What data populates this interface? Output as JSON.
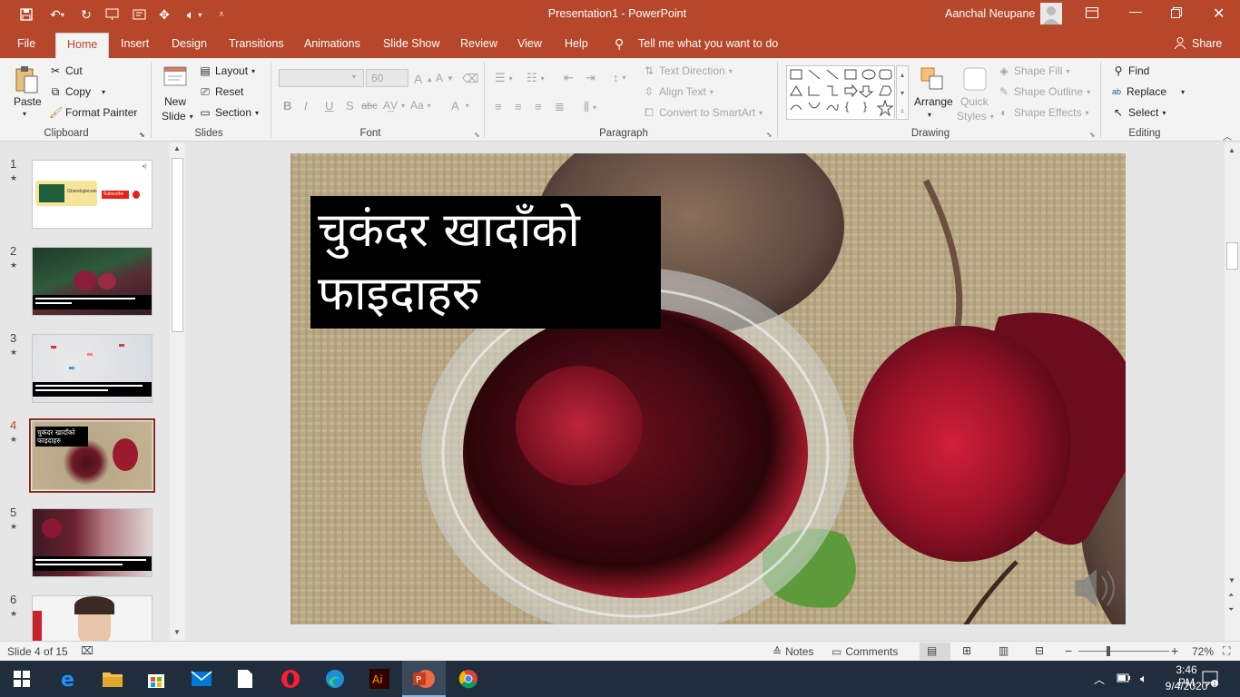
{
  "window": {
    "doc_title": "Presentation1  -  PowerPoint",
    "user_name": "Aanchal Neupane"
  },
  "tabs": [
    "File",
    "Home",
    "Insert",
    "Design",
    "Transitions",
    "Animations",
    "Slide Show",
    "Review",
    "View",
    "Help"
  ],
  "tell_me": "Tell me what you want to do",
  "share_label": "Share",
  "clipboard": {
    "paste": "Paste",
    "cut": "Cut",
    "copy": "Copy",
    "format_painter": "Format Painter",
    "group": "Clipboard"
  },
  "slides_group": {
    "new_slide_1": "New",
    "new_slide_2": "Slide",
    "layout": "Layout",
    "reset": "Reset",
    "section": "Section",
    "group": "Slides"
  },
  "font": {
    "size": "60",
    "group": "Font",
    "b": "B",
    "i": "I",
    "u": "U",
    "s": "S",
    "abc": "abc",
    "aa": "Aa",
    "a_up": "A",
    "a_color": "A"
  },
  "paragraph": {
    "text_direction": "Text Direction",
    "align_text": "Align Text",
    "smartart": "Convert to SmartArt",
    "group": "Paragraph"
  },
  "drawing": {
    "arrange": "Arrange",
    "quick_1": "Quick",
    "quick_2": "Styles",
    "shape_fill": "Shape Fill",
    "shape_outline": "Shape Outline",
    "shape_effects": "Shape Effects",
    "group": "Drawing"
  },
  "editing": {
    "find": "Find",
    "replace": "Replace",
    "select": "Select",
    "group": "Editing"
  },
  "thumbnails": [
    {
      "num": "1",
      "star": "★"
    },
    {
      "num": "2",
      "star": "★"
    },
    {
      "num": "3",
      "star": "★"
    },
    {
      "num": "4",
      "star": "★"
    },
    {
      "num": "5",
      "star": "★"
    },
    {
      "num": "6",
      "star": "★"
    }
  ],
  "thumb1": {
    "brand": "Gharelujeevan",
    "subscribe": "Subscribe"
  },
  "thumb4": {
    "title": "चुकंदर खादाँको फाइदाहरु"
  },
  "slide": {
    "title_line1": "चुकंदर  खादाँको",
    "title_line2": "फाइदाहरु"
  },
  "status": {
    "slide_info": "Slide 4 of 15",
    "notes": "Notes",
    "comments": "Comments",
    "zoom": "72%"
  },
  "clock": {
    "time": "3:46 PM",
    "date": "9/4/2020"
  },
  "colors": {
    "accent": "#b7472a",
    "taskbar": "#1f2d3d"
  },
  "icons": [
    "save-icon",
    "undo-icon",
    "redo-icon",
    "present-icon",
    "speaker-icon",
    "search-icon",
    "share-icon",
    "windows-icon",
    "edge-icon",
    "folder-icon",
    "store-icon",
    "mail-icon",
    "file-icon",
    "opera-icon",
    "illustrator-icon",
    "powerpoint-icon",
    "chrome-icon",
    "notification-icon"
  ]
}
